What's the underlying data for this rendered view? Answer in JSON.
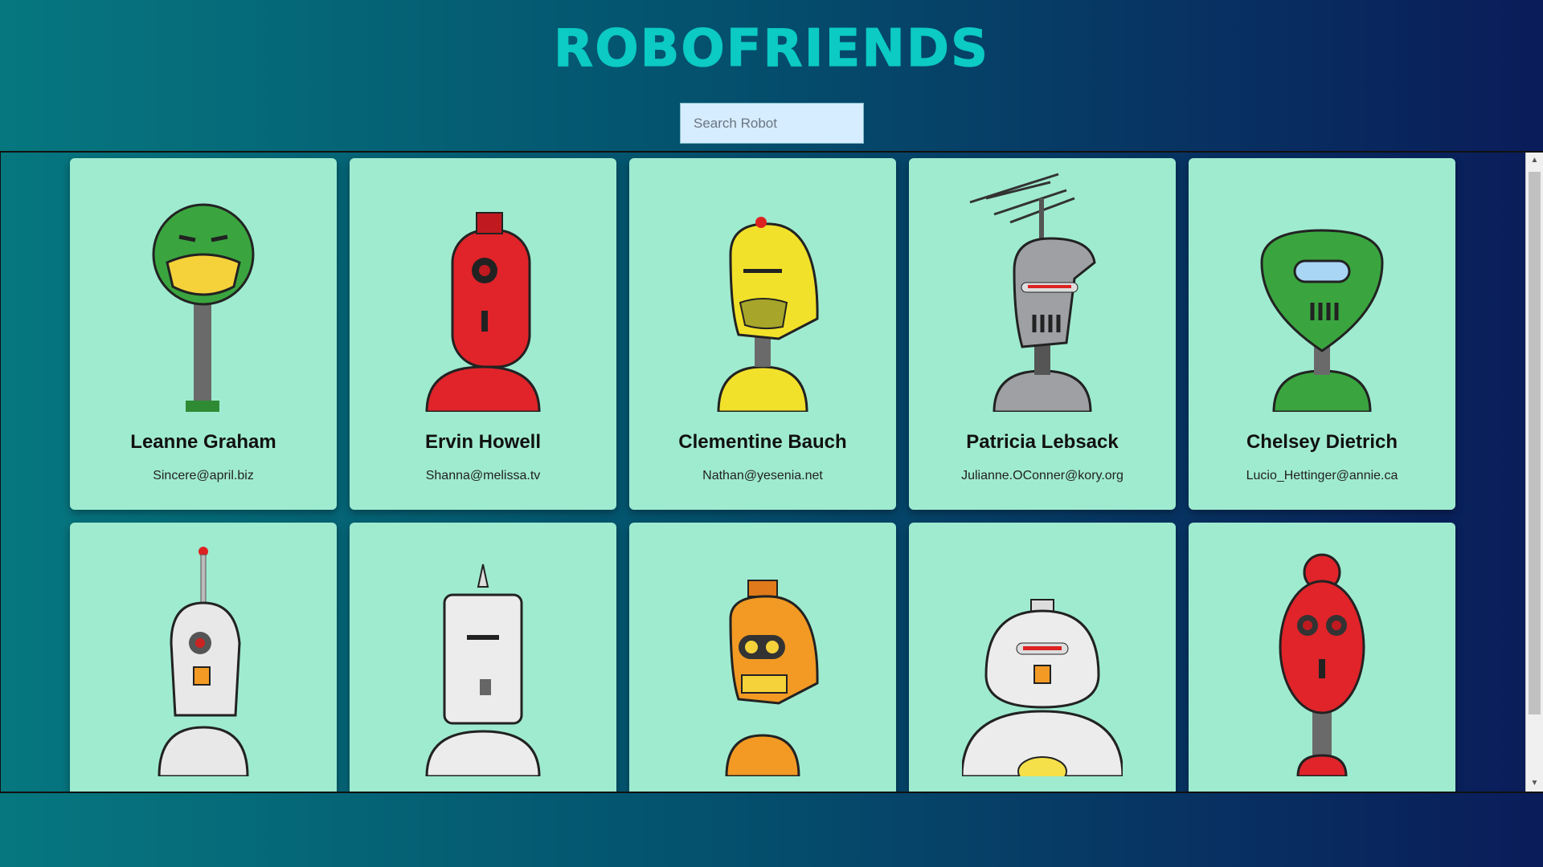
{
  "header": {
    "title": "ROBOFRIENDS"
  },
  "search": {
    "placeholder": "Search Robot",
    "value": ""
  },
  "robots": [
    {
      "name": "Leanne Graham",
      "email": "Sincere@april.biz",
      "color": "#3aa53f",
      "icon": "green-grin-robot-icon"
    },
    {
      "name": "Ervin Howell",
      "email": "Shanna@melissa.tv",
      "color": "#e0242a",
      "icon": "red-cyclops-robot-icon"
    },
    {
      "name": "Clementine Bauch",
      "email": "Nathan@yesenia.net",
      "color": "#f2e12a",
      "icon": "yellow-helmet-robot-icon"
    },
    {
      "name": "Patricia Lebsack",
      "email": "Julianne.OConner@kory.org",
      "color": "#9ea0a4",
      "icon": "gray-antenna-robot-icon"
    },
    {
      "name": "Chelsey Dietrich",
      "email": "Lucio_Hettinger@annie.ca",
      "color": "#3aa53f",
      "icon": "green-visor-robot-icon"
    },
    {
      "name": "",
      "email": "",
      "color": "#e8e8e8",
      "icon": "white-antenna-robot-icon"
    },
    {
      "name": "",
      "email": "",
      "color": "#ececec",
      "icon": "white-cylinder-robot-icon"
    },
    {
      "name": "",
      "email": "",
      "color": "#f29a24",
      "icon": "orange-robot-icon"
    },
    {
      "name": "",
      "email": "",
      "color": "#ececec",
      "icon": "white-dome-robot-icon"
    },
    {
      "name": "",
      "email": "",
      "color": "#e0242a",
      "icon": "red-oval-robot-icon"
    }
  ]
}
